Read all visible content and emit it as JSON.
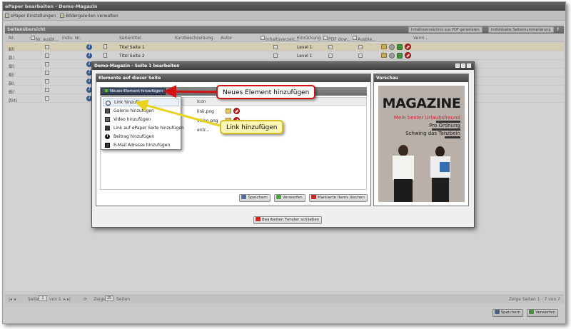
{
  "window": {
    "title": "ePaper bearbeiten - Demo-Magazin"
  },
  "menubar": {
    "items": [
      "ePaper Einstellungen",
      "Bildergalerien verwalten"
    ]
  },
  "panel": {
    "title": "Seitenübersicht",
    "btn_pdf": "Inhaltsverzeichnis aus PDF generieren",
    "btn_numbering": "Individuelle Seitennummerierung",
    "help": "?"
  },
  "grid": {
    "columns": [
      "Nr.",
      "Nr. ausbl...",
      "indiv. Nr.",
      "Seitentitel",
      "Kurzbeschreibung",
      "Autor",
      "Inhaltsverzeic...",
      "Einrückung",
      "PDF dow...",
      "Ausble...",
      "Verm..."
    ],
    "rows": [
      {
        "nr": "1",
        "sub": "(0)",
        "title": "Titel Seite 1",
        "indent": "Level 1"
      },
      {
        "nr": "2",
        "sub": "(1)",
        "title": "Titel Seite 2",
        "indent": "Level 1"
      },
      {
        "nr": "3",
        "sub": "(2)"
      },
      {
        "nr": "4",
        "sub": "(3)"
      },
      {
        "nr": "5",
        "sub": "(4)"
      },
      {
        "nr": "6",
        "sub": "(5)"
      },
      {
        "nr": "7",
        "sub": "(34)"
      }
    ]
  },
  "pager": {
    "seite": "Seite",
    "page": "1",
    "von": "von 1",
    "zeige": "Zeige",
    "per_page": "25",
    "seiten": "Seiten",
    "summary": "Zeige Seiten 1 - 7 von 7"
  },
  "footer": {
    "save": "Speichern",
    "discard": "Verwerfen"
  },
  "dialog": {
    "title": "Demo-Magazin - Seite 1 bearbeiten",
    "left_title": "Elemente auf dieser Seite",
    "new_button": "Neues Element hinzufügen",
    "col_icon": "Icon",
    "rows": [
      "link.png",
      "video.png",
      "entr..."
    ],
    "save": "Speichern",
    "discard": "Verwerfen",
    "delete_marked": "Markierte Items löschen",
    "close": "Bearbeiten Fenster schließen",
    "preview_title": "Vorschau"
  },
  "menu": {
    "items": [
      "Link hinzufügen",
      "Galerie hinzufügen",
      "Video hinzufügen",
      "Link auf ePaper Seite hinzufügen",
      "Beitrag hinzufügen",
      "E-Mail Adresse hinzufügen"
    ]
  },
  "preview": {
    "masthead": "MAGAZINE",
    "line1": "Mein bester Urlaubsfreund",
    "line2": "Pro Ordnung",
    "line3": "Schwing das Tanzbein"
  },
  "callouts": {
    "red": "Neues Element hinzufügen",
    "yellow": "Link hinzufügen"
  },
  "colors": {
    "callout_red": "#d01414",
    "callout_yellow": "#d6bf22",
    "row_selected": "#f6eccd"
  }
}
